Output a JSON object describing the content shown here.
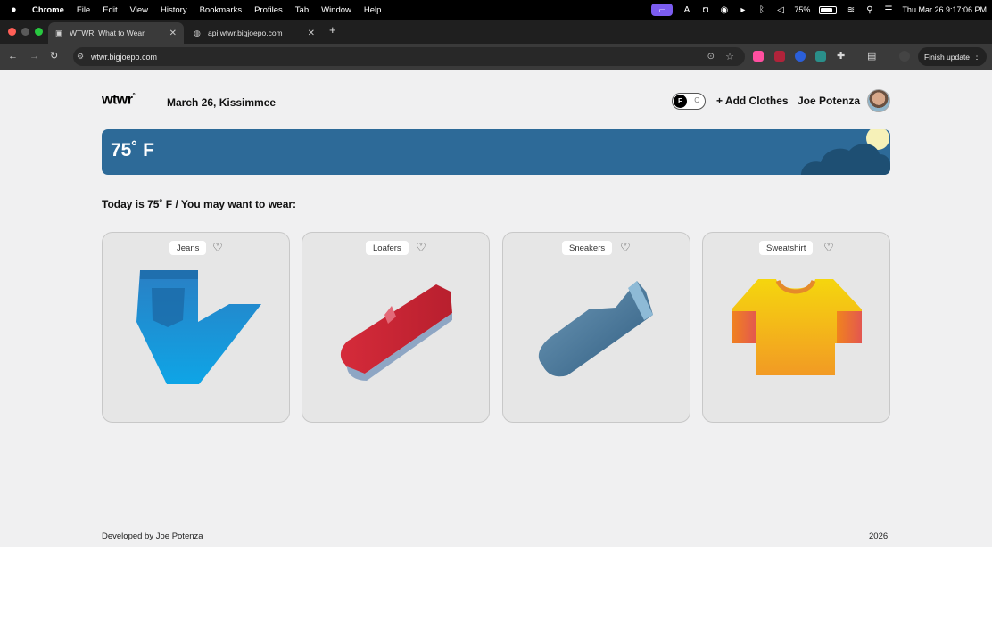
{
  "menubar": {
    "app": "Chrome",
    "items": [
      "File",
      "Edit",
      "View",
      "History",
      "Bookmarks",
      "Profiles",
      "Tab",
      "Window",
      "Help"
    ],
    "battery": "75%",
    "clock": "Thu Mar 26  9:17:06 PM"
  },
  "tabs": [
    {
      "title": "WTWR: What to Wear",
      "active": true
    },
    {
      "title": "api.wtwr.bigjoepo.com",
      "active": false
    }
  ],
  "toolbar": {
    "url": "wtwr.bigjoepo.com",
    "finish_update": "Finish update"
  },
  "header": {
    "logo": "wtwr",
    "logo_mark": "°",
    "date_location": "March 26, Kissimmee",
    "toggle_on": "F",
    "toggle_off": "C",
    "add_clothes": "+ Add Clothes",
    "username": "Joe Potenza"
  },
  "weather": {
    "temp": "75˚ F",
    "sky_color": "#2d6a98"
  },
  "suggestion": "Today is 75˚ F / You may want to wear:",
  "items": [
    {
      "name": "Jeans",
      "icon": "jeans-icon"
    },
    {
      "name": "Loafers",
      "icon": "loafers-icon"
    },
    {
      "name": "Sneakers",
      "icon": "sneakers-icon"
    },
    {
      "name": "Sweatshirt",
      "icon": "sweatshirt-icon"
    }
  ],
  "footer": {
    "credit": "Developed by Joe Potenza",
    "year": "2026"
  }
}
